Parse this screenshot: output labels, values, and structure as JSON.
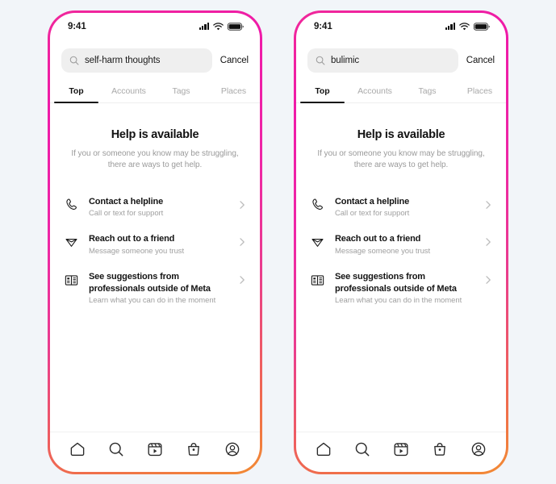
{
  "background_color": "#f2f5f9",
  "frame_gradient": {
    "from": "#f0289a",
    "mid": "#ee26a6",
    "to": "#f28b33"
  },
  "phones": [
    {
      "status_bar": {
        "time": "9:41",
        "signal_icon": "signal-bars-icon",
        "wifi_icon": "wifi-icon",
        "battery_icon": "battery-icon"
      },
      "search": {
        "icon": "search-icon",
        "value": "self-harm thoughts",
        "placeholder": "Search",
        "cancel_label": "Cancel"
      },
      "tabs": [
        {
          "label": "Top",
          "active": true
        },
        {
          "label": "Accounts",
          "active": false
        },
        {
          "label": "Tags",
          "active": false
        },
        {
          "label": "Places",
          "active": false
        }
      ],
      "help": {
        "title": "Help is available",
        "subtitle": "If you or someone you know may be struggling, there are ways to get help."
      },
      "options": [
        {
          "icon": "phone-icon",
          "title": "Contact a helpline",
          "desc": "Call or text for support",
          "chevron": "chevron-right-icon"
        },
        {
          "icon": "send-icon",
          "title": "Reach out to a friend",
          "desc": "Message someone you trust",
          "chevron": "chevron-right-icon"
        },
        {
          "icon": "book-icon",
          "title": "See suggestions from professionals outside of Meta",
          "desc": "Learn what you can do in the moment",
          "chevron": "chevron-right-icon"
        }
      ],
      "bottom_nav": [
        {
          "icon": "home-icon",
          "label": "Home"
        },
        {
          "icon": "search-icon",
          "label": "Search"
        },
        {
          "icon": "reels-icon",
          "label": "Reels"
        },
        {
          "icon": "shop-icon",
          "label": "Shop"
        },
        {
          "icon": "profile-icon",
          "label": "Profile"
        }
      ]
    },
    {
      "status_bar": {
        "time": "9:41",
        "signal_icon": "signal-bars-icon",
        "wifi_icon": "wifi-icon",
        "battery_icon": "battery-icon"
      },
      "search": {
        "icon": "search-icon",
        "value": "bulimic",
        "placeholder": "Search",
        "cancel_label": "Cancel"
      },
      "tabs": [
        {
          "label": "Top",
          "active": true
        },
        {
          "label": "Accounts",
          "active": false
        },
        {
          "label": "Tags",
          "active": false
        },
        {
          "label": "Places",
          "active": false
        }
      ],
      "help": {
        "title": "Help is available",
        "subtitle": "If you or someone you know may be struggling, there are ways to get help."
      },
      "options": [
        {
          "icon": "phone-icon",
          "title": "Contact a helpline",
          "desc": "Call or text for support",
          "chevron": "chevron-right-icon"
        },
        {
          "icon": "send-icon",
          "title": "Reach out to a friend",
          "desc": "Message someone you trust",
          "chevron": "chevron-right-icon"
        },
        {
          "icon": "book-icon",
          "title": "See suggestions from professionals outside of Meta",
          "desc": "Learn what you can do in the moment",
          "chevron": "chevron-right-icon"
        }
      ],
      "bottom_nav": [
        {
          "icon": "home-icon",
          "label": "Home"
        },
        {
          "icon": "search-icon",
          "label": "Search"
        },
        {
          "icon": "reels-icon",
          "label": "Reels"
        },
        {
          "icon": "shop-icon",
          "label": "Shop"
        },
        {
          "icon": "profile-icon",
          "label": "Profile"
        }
      ]
    }
  ]
}
